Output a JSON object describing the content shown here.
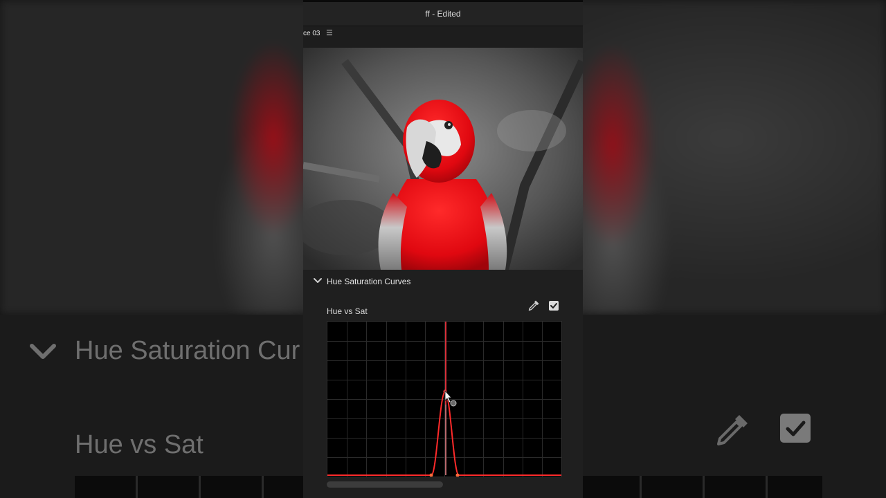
{
  "window": {
    "title": "ff - Edited"
  },
  "sequence": {
    "tab_label": "ce 03",
    "menu_icon": "hamburger-menu-icon"
  },
  "viewer": {
    "subject": "parrot-photo"
  },
  "panel": {
    "section_title": "Hue Saturation Curves",
    "curve_label": "Hue vs Sat",
    "eyedropper_icon": "eyedropper-icon",
    "enabled": true
  },
  "curve": {
    "spectrum_colors": [
      "#3050ff",
      "#7a30ff",
      "#c020d0",
      "#ff2050",
      "#ff6020",
      "#ffd020",
      "#40e040",
      "#30d0a0"
    ],
    "peak_color": "#ff2a2a",
    "selection_line_color": "#d8303a"
  },
  "background": {
    "section_title": "Hue Saturation Cur",
    "curve_label": "Hue vs Sat"
  }
}
